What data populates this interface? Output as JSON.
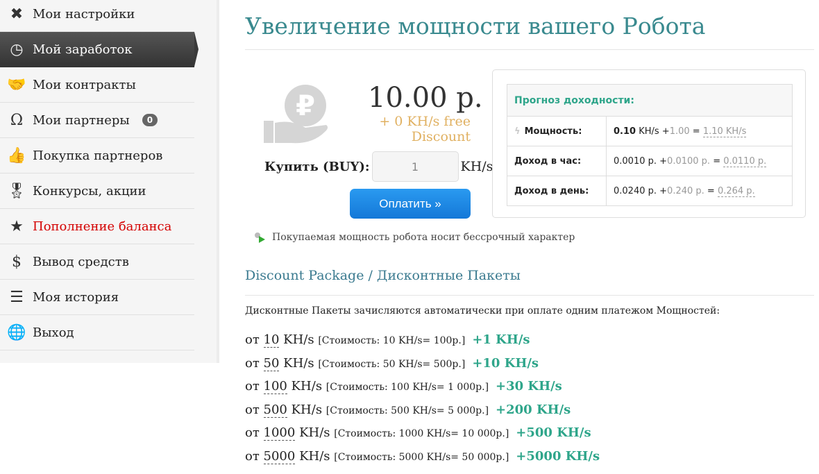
{
  "sidebar": {
    "items": [
      {
        "label": "Мои настройки",
        "icon": "tools-icon"
      },
      {
        "label": "Мой заработок",
        "icon": "clock-icon",
        "active": true
      },
      {
        "label": "Мои контракты",
        "icon": "handshake-icon"
      },
      {
        "label": "Мои партнеры",
        "icon": "partners-icon",
        "badge": "0"
      },
      {
        "label": "Покупка партнеров",
        "icon": "thumbs-up-icon"
      },
      {
        "label": "Конкурсы, акции",
        "icon": "award-icon"
      },
      {
        "label": "Пополнение баланса",
        "icon": "star-icon",
        "highlight": "#d40000"
      },
      {
        "label": "Вывод средств",
        "icon": "dollar-icon"
      },
      {
        "label": "Моя история",
        "icon": "server-icon"
      },
      {
        "label": "Выход",
        "icon": "globe-icon"
      }
    ]
  },
  "page": {
    "title": "Увеличение мощности вашего Робота"
  },
  "purchase": {
    "price": "10.00 р.",
    "discount": "+ 0 KH/s free Discount",
    "buy_label": "Купить (BUY):",
    "quantity": "1",
    "unit": "KH/s",
    "pay_button": "Оплатить »",
    "note": "Покупаемая мощность робота носит бессрочный характер"
  },
  "forecast": {
    "title": "Прогноз доходности:",
    "rows": [
      {
        "label": "Мощность:",
        "base": "0.10",
        "base_unit": " KH/s +",
        "bonus": "1.00",
        "eq": " = ",
        "total": "1.10 KH/s"
      },
      {
        "label": "Доход в час:",
        "base": "0.0010 р.",
        "base_unit": " +",
        "bonus": "0.0100 р.",
        "eq": " = ",
        "total": "0.0110 р."
      },
      {
        "label": "Доход в день:",
        "base": "0.0240 р.",
        "base_unit": " +",
        "bonus": "0.240 р.",
        "eq": " = ",
        "total": "0.264 р."
      }
    ]
  },
  "packages": {
    "title": "Discount Package / Дисконтные Пакеты",
    "intro": "Дисконтные Пакеты зачисляются автоматически при оплате одним платежом Мощностей:",
    "items": [
      {
        "prefix": "от ",
        "amount": "10",
        "unit": " KH/s ",
        "cost": "[Стоимость: 10 KH/s= 100р.]",
        "bonus": "+1 KH/s"
      },
      {
        "prefix": "от ",
        "amount": "50",
        "unit": " KH/s ",
        "cost": "[Стоимость: 50 KH/s= 500р.]",
        "bonus": "+10 KH/s"
      },
      {
        "prefix": "от ",
        "amount": "100",
        "unit": " KH/s ",
        "cost": "[Стоимость: 100 KH/s= 1 000р.]",
        "bonus": "+30 KH/s"
      },
      {
        "prefix": "от ",
        "amount": "500",
        "unit": " KH/s ",
        "cost": "[Стоимость: 500 KH/s= 5 000р.]",
        "bonus": "+200 KH/s"
      },
      {
        "prefix": "от ",
        "amount": "1000",
        "unit": " KH/s ",
        "cost": "[Стоимость: 1000 KH/s= 10 000р.]",
        "bonus": "+500 KH/s"
      },
      {
        "prefix": "от ",
        "amount": "5000",
        "unit": " KH/s ",
        "cost": "[Стоимость: 5000 KH/s= 50 000р.]",
        "bonus": "+5000 KH/s"
      }
    ]
  }
}
